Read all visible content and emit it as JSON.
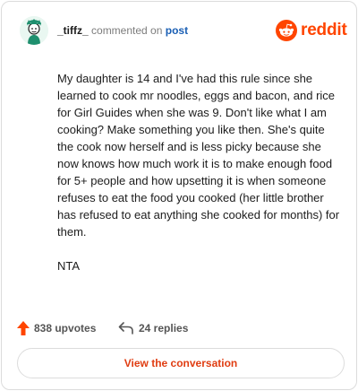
{
  "header": {
    "username": "_tiffz_",
    "commented_text": "commented on",
    "post_link": "post",
    "brand": "reddit"
  },
  "comment": {
    "paragraphs": [
      "My daughter is 14 and I've had this rule since she learned to cook mr noodles, eggs and bacon, and rice for Girl Guides when she was 9. Don't like what I am cooking? Make something you like then. She's quite the cook now herself and is less picky because she now knows how much work it is to make enough food for 5+ people and how upsetting it is when someone refuses to eat the food you cooked (her little brother has refused to eat anything she cooked for months) for them.",
      "NTA"
    ]
  },
  "stats": {
    "upvotes": "838 upvotes",
    "replies": "24 replies"
  },
  "actions": {
    "view_conversation": "View the conversation"
  },
  "colors": {
    "brand": "#ff4500",
    "link": "#1a5fb4",
    "button_text": "#e03d12",
    "avatar_accent": "#1e8f6e"
  },
  "icons": {
    "avatar": "user-avatar",
    "logo": "reddit-snoo-icon",
    "upvote": "upvote-arrow-icon",
    "reply": "reply-arrow-icon"
  }
}
